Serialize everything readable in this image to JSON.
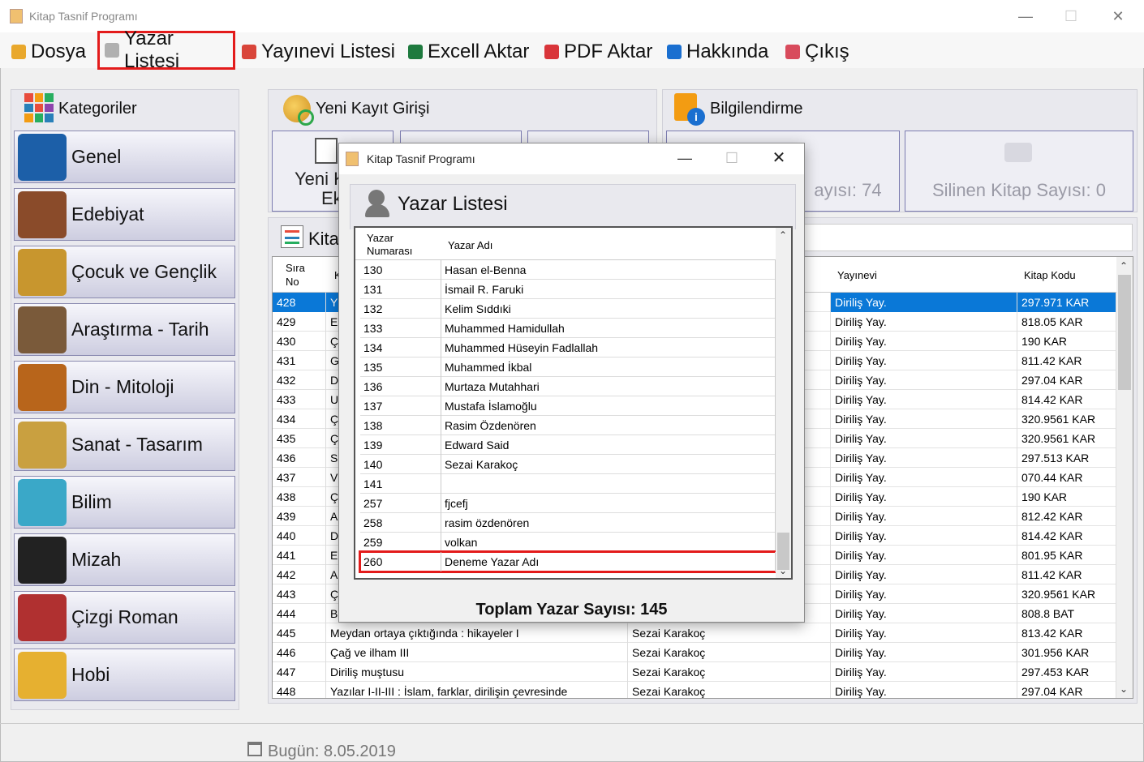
{
  "window": {
    "title": "Kitap Tasnif Programı",
    "controls": [
      "—",
      "☐",
      "✕"
    ]
  },
  "menu": [
    {
      "label": "Dosya",
      "icon": "folder-icon",
      "color": "#e9a82c"
    },
    {
      "label": "Yazar Listesi",
      "icon": "user-doc-icon",
      "color": "#b0b0b0"
    },
    {
      "label": "Yayınevi Listesi",
      "icon": "home-icon",
      "color": "#d9453a"
    },
    {
      "label": "Excell Aktar",
      "icon": "excel-icon",
      "color": "#1e7a3e"
    },
    {
      "label": "PDF Aktar",
      "icon": "pdf-icon",
      "color": "#d9353a"
    },
    {
      "label": "Hakkında",
      "icon": "info-icon",
      "color": "#1a6fd0"
    },
    {
      "label": "Çıkış",
      "icon": "exit-icon",
      "color": "#d84b5c"
    }
  ],
  "categories": {
    "title": "Kategoriler",
    "items": [
      {
        "label": "Genel",
        "icon": "road-sign-icon",
        "color": "#1c5fa8"
      },
      {
        "label": "Edebiyat",
        "icon": "books-icon",
        "color": "#8a4b2a"
      },
      {
        "label": "Çocuk ve Gençlik",
        "icon": "owl-icon",
        "color": "#c8962e"
      },
      {
        "label": "Araştırma - Tarih",
        "icon": "book-stack-icon",
        "color": "#7a5a3a"
      },
      {
        "label": "Din - Mitoloji",
        "icon": "praying-hands-icon",
        "color": "#b8651b"
      },
      {
        "label": "Sanat - Tasarım",
        "icon": "palette-icon",
        "color": "#c9a040"
      },
      {
        "label": "Bilim",
        "icon": "flask-icon",
        "color": "#3aa8c8"
      },
      {
        "label": "Mizah",
        "icon": "mickey-icon",
        "color": "#222222"
      },
      {
        "label": "Çizgi Roman",
        "icon": "camera-icon",
        "color": "#b03030"
      },
      {
        "label": "Hobi",
        "icon": "star-folder-icon",
        "color": "#e6b030"
      }
    ]
  },
  "new_record": {
    "title": "Yeni Kayıt Girişi",
    "button_partial": [
      "Yeni K",
      "Ekl"
    ]
  },
  "info": {
    "title": "Bilgilendirme",
    "count_partial": "ayısı: 74",
    "deleted": "Silinen Kitap Sayısı: 0"
  },
  "books": {
    "title_partial": "Kita",
    "headers": {
      "no_line1": "Sıra",
      "no_line2": "No",
      "title_partial": "K",
      "publisher": "Yayınevi",
      "code": "Kitap Kodu"
    },
    "rows": [
      {
        "no": "428",
        "t": "Y",
        "a": "",
        "p": "Diriliş Yay.",
        "c": "297.971 KAR",
        "selected": true
      },
      {
        "no": "429",
        "t": "E",
        "a": "",
        "p": "Diriliş Yay.",
        "c": "818.05 KAR"
      },
      {
        "no": "430",
        "t": "Ç",
        "a": "",
        "p": "Diriliş Yay.",
        "c": "190 KAR"
      },
      {
        "no": "431",
        "t": "G",
        "a": "",
        "p": "Diriliş Yay.",
        "c": "811.42 KAR"
      },
      {
        "no": "432",
        "t": "D",
        "a": "",
        "p": "Diriliş Yay.",
        "c": "297.04 KAR"
      },
      {
        "no": "433",
        "t": "U",
        "a": "",
        "p": "Diriliş Yay.",
        "c": "814.42 KAR"
      },
      {
        "no": "434",
        "t": "Ç",
        "a": "",
        "p": "Diriliş Yay.",
        "c": "320.9561 KAR"
      },
      {
        "no": "435",
        "t": "Ç",
        "a": "",
        "p": "Diriliş Yay.",
        "c": "320.9561 KAR"
      },
      {
        "no": "436",
        "t": "S",
        "a": "",
        "p": "Diriliş Yay.",
        "c": "297.513 KAR"
      },
      {
        "no": "437",
        "t": "V",
        "a": "",
        "p": "Diriliş Yay.",
        "c": "070.44 KAR"
      },
      {
        "no": "438",
        "t": "Ç",
        "a": "",
        "p": "Diriliş Yay.",
        "c": "190 KAR"
      },
      {
        "no": "439",
        "t": "A",
        "a": "",
        "p": "Diriliş Yay.",
        "c": "812.42 KAR"
      },
      {
        "no": "440",
        "t": "D",
        "a": "",
        "p": "Diriliş Yay.",
        "c": "814.42 KAR"
      },
      {
        "no": "441",
        "t": "E",
        "a": "",
        "p": "Diriliş Yay.",
        "c": "801.95 KAR"
      },
      {
        "no": "442",
        "t": "A",
        "a": "",
        "p": "Diriliş Yay.",
        "c": "811.42 KAR"
      },
      {
        "no": "443",
        "t": "Ç",
        "a": "",
        "p": "Diriliş Yay.",
        "c": "320.9561 KAR"
      },
      {
        "no": "444",
        "t": "B",
        "a": "",
        "p": "Diriliş Yay.",
        "c": "808.8 BAT"
      },
      {
        "no": "445",
        "t": "Meydan ortaya çıktığında : hikayeler I",
        "a": "Sezai Karakoç",
        "p": "Diriliş Yay.",
        "c": "813.42 KAR"
      },
      {
        "no": "446",
        "t": "Çağ ve ilham III",
        "a": "Sezai Karakoç",
        "p": "Diriliş Yay.",
        "c": "301.956 KAR"
      },
      {
        "no": "447",
        "t": "Diriliş muştusu",
        "a": "Sezai Karakoç",
        "p": "Diriliş Yay.",
        "c": "297.453 KAR"
      },
      {
        "no": "448",
        "t": "Yazılar I-II-III : İslam, farklar, dirilişin çevresinde",
        "a": "Sezai Karakoç",
        "p": "Diriliş Yay.",
        "c": "297.04 KAR"
      }
    ]
  },
  "dialog": {
    "title": "Kitap Tasnif Programı",
    "header": "Yazar Listesi",
    "col_no_line1": "Yazar",
    "col_no_line2": "Numarası",
    "col_name": "Yazar Adı",
    "rows": [
      {
        "no": "130",
        "name": "Hasan el-Benna"
      },
      {
        "no": "131",
        "name": "İsmail R. Faruki"
      },
      {
        "no": "132",
        "name": "Kelim Sıddıki"
      },
      {
        "no": "133",
        "name": "Muhammed Hamidullah"
      },
      {
        "no": "134",
        "name": "Muhammed Hüseyin Fadlallah"
      },
      {
        "no": "135",
        "name": "Muhammed İkbal"
      },
      {
        "no": "136",
        "name": "Murtaza Mutahhari"
      },
      {
        "no": "137",
        "name": "Mustafa İslamoğlu"
      },
      {
        "no": "138",
        "name": "Rasim Özdenören"
      },
      {
        "no": "139",
        "name": "Edward Said"
      },
      {
        "no": "140",
        "name": "Sezai Karakoç"
      },
      {
        "no": "141",
        "name": ""
      },
      {
        "no": "257",
        "name": "fjcefj"
      },
      {
        "no": "258",
        "name": "rasim özdenören"
      },
      {
        "no": "259",
        "name": "volkan"
      },
      {
        "no": "260",
        "name": "Deneme Yazar Adı",
        "highlighted": true
      }
    ],
    "total": "Toplam Yazar Sayısı: 145"
  },
  "status": {
    "date": "Bugün: 8.05.2019"
  }
}
